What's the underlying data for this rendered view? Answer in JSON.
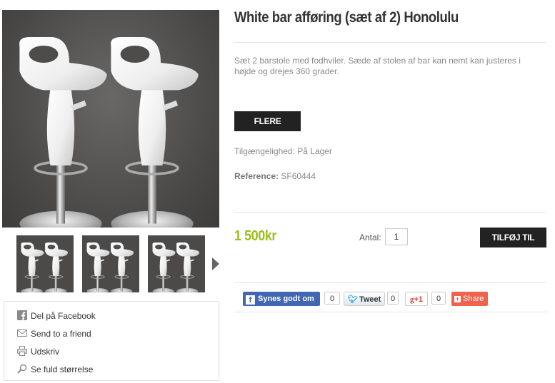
{
  "product": {
    "title": "White bar afføring (sæt af 2) Honolulu",
    "description": "Sæt 2 barstole med fodhviler. Sæde af stolen af bar kan nemt kan justeres i højde og drejes 360 grader.",
    "more_details_label": "FLERE DETALJER",
    "availability": "Tilgængelighed: På Lager",
    "reference_label": "Reference:",
    "reference_value": "SF60444",
    "price": "1 500kr",
    "quantity_label": "Antal:",
    "quantity_value": "1",
    "add_to_cart_label": "TILFØJ TIL KURV"
  },
  "share_links": [
    {
      "label": "Del på Facebook",
      "icon": "facebook-icon"
    },
    {
      "label": "Send to a friend",
      "icon": "envelope-icon"
    },
    {
      "label": "Udskriv",
      "icon": "printer-icon"
    },
    {
      "label": "Se fuld størrelse",
      "icon": "magnifier-icon"
    }
  ],
  "social": {
    "facebook_label": "Synes godt om",
    "facebook_count": "0",
    "tweet_label": "Tweet",
    "tweet_count": "0",
    "gplus_label": "+1",
    "gplus_count": "0",
    "share_label": "Share"
  },
  "colors": {
    "price": "#9bbf1d",
    "button_bg": "#222222",
    "facebook": "#4267b2",
    "share": "#f0624c"
  }
}
